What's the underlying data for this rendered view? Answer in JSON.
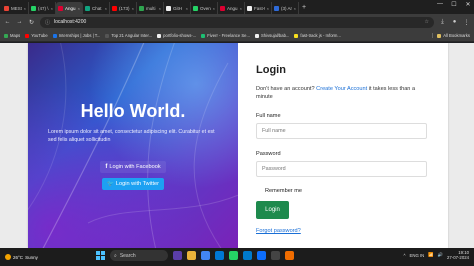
{
  "browser": {
    "tabs": [
      {
        "label": "MESS",
        "color": "#ea4335",
        "active": false
      },
      {
        "label": "(47) \\",
        "color": "#25d366",
        "active": false
      },
      {
        "label": "Angu",
        "color": "#dd0031",
        "active": true
      },
      {
        "label": "Chat",
        "color": "#10a37f",
        "active": false
      },
      {
        "label": "(173)",
        "color": "#ff0000",
        "active": false
      },
      {
        "label": "multi",
        "color": "#2ea44f",
        "active": false
      },
      {
        "label": "GitH",
        "color": "#f0f0f0",
        "active": false
      },
      {
        "label": "Overv",
        "color": "#25d366",
        "active": false
      },
      {
        "label": "Angu",
        "color": "#dd0031",
        "active": false
      },
      {
        "label": "Fast-t",
        "color": "#f0f0f0",
        "active": false
      },
      {
        "label": "(3) Ar",
        "color": "#2e6ad8",
        "active": false
      }
    ],
    "url": "localhost:4200",
    "bookmarks": [
      {
        "label": "Maps",
        "color": "#34a853"
      },
      {
        "label": "YouTube",
        "color": "#ff0000"
      },
      {
        "label": "Internships | Jobs | T...",
        "color": "#1a73e8"
      },
      {
        "label": "Top 21 Angular Inter...",
        "color": "#555555"
      },
      {
        "label": "portfolio-shows-...",
        "color": "#f0f0f0"
      },
      {
        "label": "Fiverr - Freelance Se...",
        "color": "#1dbf73"
      },
      {
        "label": "Shivsujal/bab...",
        "color": "#f0f0f0"
      },
      {
        "label": "fast-track js - Inform...",
        "color": "#f7df1e"
      }
    ],
    "all_bookmarks": "All Bookmarks"
  },
  "hero": {
    "title": "Hello World.",
    "text": "Lorem ipsum dolor sit amet, consectetur adipiscing elit. Curabitur et est sed felis aliquet sollicitudin",
    "facebook_label": "Login with Facebook",
    "twitter_label": "Login with Twitter"
  },
  "login": {
    "title": "Login",
    "prompt": "Don't have an account?",
    "create_link": "Create Your Account",
    "prompt_tail": "it takes less than a minute",
    "fullname_label": "Full name",
    "fullname_placeholder": "Full name",
    "password_label": "Password",
    "password_placeholder": "Password",
    "remember_label": "Remember me",
    "login_button": "Login",
    "forgot_link": "Forgot password?"
  },
  "taskbar": {
    "weather_temp": "26°C",
    "weather_desc": "Sunny",
    "search_placeholder": "Search",
    "language": "ENG IN",
    "time": "19:10",
    "date": "27-07-2024"
  },
  "colors": {
    "accent_link": "#1a6fd6",
    "login_button": "#1e8a4d",
    "twitter": "#1da1f2"
  }
}
